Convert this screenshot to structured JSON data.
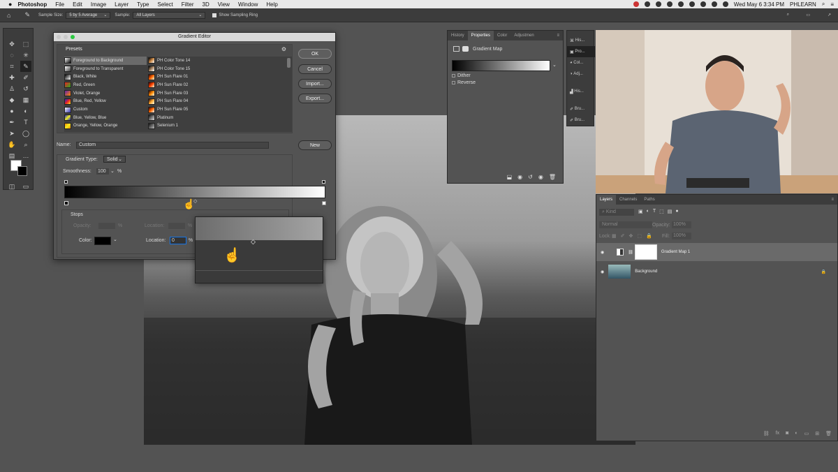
{
  "menubar": {
    "app": "Photoshop",
    "items": [
      "File",
      "Edit",
      "Image",
      "Layer",
      "Type",
      "Select",
      "Filter",
      "3D",
      "View",
      "Window",
      "Help"
    ],
    "datetime": "Wed May 6  3:34 PM",
    "user": "PHLEARN"
  },
  "options": {
    "sample_size_label": "Sample Size:",
    "sample_size_value": "5 by 5 Average",
    "sample_label": "Sample:",
    "sample_value": "All Layers",
    "show_ring": "Show Sampling Ring"
  },
  "gradient_editor": {
    "title": "Gradient Editor",
    "presets_label": "Presets",
    "presets_left": [
      "Foreground to Background",
      "Foreground to Transparent",
      "Black, White",
      "Red, Green",
      "Violet, Orange",
      "Blue, Red, Yellow",
      "Custom",
      "Blue, Yellow, Blue",
      "Orange, Yellow, Orange"
    ],
    "presets_right": [
      "PH Color Tone 14",
      "PH Color Tone 15",
      "PH Sun Flare 01",
      "PH Sun Flare 02",
      "PH Sun Flare 03",
      "PH Sun Flare 04",
      "PH Sun Flare 05",
      "Platinum",
      "Selenium 1"
    ],
    "buttons": {
      "ok": "OK",
      "cancel": "Cancel",
      "import": "Import...",
      "export": "Export...",
      "new": "New"
    },
    "name_label": "Name:",
    "name_value": "Custom",
    "type_label": "Gradient Type:",
    "type_value": "Solid",
    "smoothness_label": "Smoothness:",
    "smoothness_value": "100",
    "percent": "%",
    "stops_label": "Stops",
    "opacity_label": "Opacity:",
    "location_label": "Location:",
    "color_label": "Color:",
    "location_value": "0"
  },
  "properties": {
    "tabs": [
      "History",
      "Properties",
      "Color",
      "Adjustmen"
    ],
    "title": "Gradient Map",
    "dither": "Dither",
    "reverse": "Reverse"
  },
  "strip": [
    "His...",
    "Pro...",
    "Col...",
    "Adj...",
    "His...",
    "Bru...",
    "Bru..."
  ],
  "layers": {
    "tabs": [
      "Layers",
      "Channels",
      "Paths"
    ],
    "kind_placeholder": "Kind",
    "blend_mode": "Normal",
    "opacity_label": "Opacity:",
    "opacity_value": "100%",
    "lock_label": "Lock:",
    "fill_label": "Fill:",
    "fill_value": "100%",
    "rows": [
      {
        "name": "Gradient Map 1"
      },
      {
        "name": "Background"
      }
    ]
  },
  "colors": {
    "accent": "#1473e6",
    "panel": "#535353",
    "dark": "#3c3c3c"
  }
}
